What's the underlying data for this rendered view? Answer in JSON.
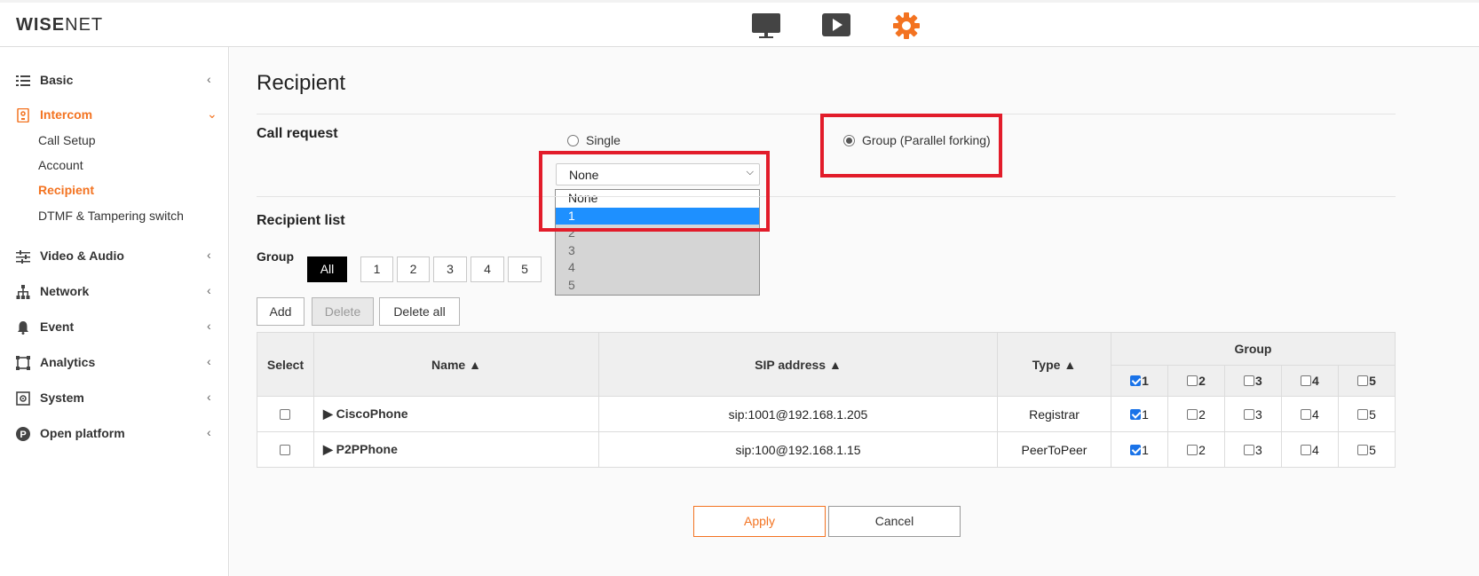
{
  "header": {
    "logo_bold": "WISE",
    "logo_thin": "NET",
    "icons": [
      "monitor-icon",
      "play-icon",
      "gear-icon"
    ]
  },
  "sidebar": {
    "menus": [
      {
        "label": "Basic",
        "icon": "list-icon"
      },
      {
        "label": "Intercom",
        "icon": "intercom-icon"
      },
      {
        "label": "Video & Audio",
        "icon": "sliders-icon"
      },
      {
        "label": "Network",
        "icon": "network-icon"
      },
      {
        "label": "Event",
        "icon": "bell-icon"
      },
      {
        "label": "Analytics",
        "icon": "analytics-icon"
      },
      {
        "label": "System",
        "icon": "system-icon"
      },
      {
        "label": "Open platform",
        "icon": "platform-icon"
      }
    ],
    "intercom_sub": [
      "Call Setup",
      "Account",
      "Recipient",
      "DTMF & Tampering switch"
    ]
  },
  "main": {
    "title": "Recipient",
    "call_request": {
      "label": "Call request",
      "single_label": "Single",
      "group_label": "Group (Parallel forking)",
      "select_value": "None",
      "options": [
        "None",
        "1",
        "2",
        "3",
        "4",
        "5"
      ]
    },
    "recipient_list": {
      "label": "Recipient list",
      "group_label": "Group",
      "group_buttons": [
        "All",
        "1",
        "2",
        "3",
        "4",
        "5"
      ],
      "actions": {
        "add": "Add",
        "delete": "Delete",
        "delete_all": "Delete all"
      },
      "table": {
        "headers": {
          "select": "Select",
          "name": "Name ▲",
          "sip": "SIP address ▲",
          "type": "Type ▲",
          "group": "Group"
        },
        "group_cols": [
          "1",
          "2",
          "3",
          "4",
          "5"
        ],
        "rows": [
          {
            "name": "▶ CiscoPhone",
            "sip": "sip:1001@192.168.1.205",
            "type": "Registrar"
          },
          {
            "name": "▶ P2PPhone",
            "sip": "sip:100@192.168.1.15",
            "type": "PeerToPeer"
          }
        ]
      }
    },
    "apply_label": "Apply",
    "cancel_label": "Cancel"
  },
  "colors": {
    "accent": "#f37321",
    "highlight": "#e21c2a",
    "selection": "#1e90ff"
  }
}
